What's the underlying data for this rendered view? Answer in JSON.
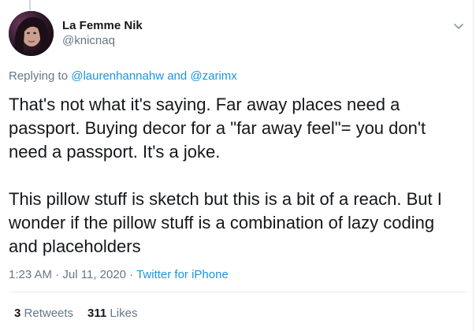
{
  "author": {
    "display_name": "La Femme Nik",
    "handle": "@knicnaq"
  },
  "replying": {
    "prefix": "Replying to ",
    "user1": "@laurenhannahw",
    "conj": " and ",
    "user2": "@zarimx"
  },
  "tweet": {
    "paragraph1": "That's not what it's saying. Far away places need a passport. Buying decor for a \"far away feel\"= you don't need a passport. It's a joke.",
    "paragraph2": "This pillow stuff is sketch but this is a bit of a reach. But I wonder if the pillow stuff is a combination of lazy coding and placeholders"
  },
  "meta": {
    "time": "1:23 AM",
    "sep1": " · ",
    "date": "Jul 11, 2020",
    "sep2": " · ",
    "source": "Twitter for iPhone"
  },
  "stats": {
    "retweets_count": "3",
    "retweets_label": "Retweets",
    "likes_count": "311",
    "likes_label": "Likes"
  },
  "colors": {
    "link": "#1b95e0",
    "secondary_text": "#657786",
    "primary_text": "#14171a",
    "divider": "#e6ecf0"
  },
  "icons": {
    "caret": "chevron-down-icon",
    "avatar": "avatar"
  }
}
